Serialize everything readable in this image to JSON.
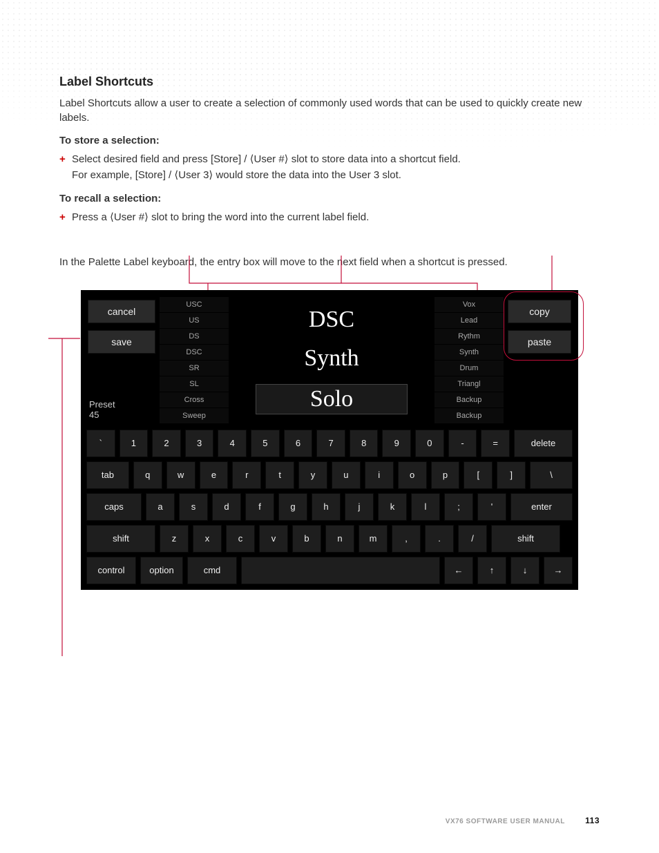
{
  "heading": "Label Shortcuts",
  "intro": "Label Shortcuts allow a user to create a selection of commonly used words that can be used to quickly create new labels.",
  "store_heading": "To store a selection:",
  "store_bullet_line1": "Select desired field and press [Store] / ⟨User #⟩ slot to store data into a shortcut field.",
  "store_bullet_line2": "For example, [Store] / ⟨User 3⟩ would store the data into the User 3 slot.",
  "recall_heading": "To recall a selection:",
  "recall_bullet": "Press a ⟨User #⟩ slot to bring the word into the current label field.",
  "note": "In the Palette Label keyboard, the entry box will move to the next field when a shortcut is pressed.",
  "panel": {
    "cancel": "cancel",
    "save": "save",
    "preset_label": "Preset",
    "preset_num": "45",
    "left_shortcuts": [
      "USC",
      "US",
      "DS",
      "DSC",
      "SR",
      "SL",
      "Cross",
      "Sweep"
    ],
    "entries": [
      "DSC",
      "Synth",
      "Solo"
    ],
    "right_shortcuts": [
      "Vox",
      "Lead",
      "Rythm",
      "Synth",
      "Drum",
      "Triangl",
      "Backup",
      "Backup"
    ],
    "copy": "copy",
    "paste": "paste"
  },
  "keyboard": {
    "row1": [
      "`",
      "1",
      "2",
      "3",
      "4",
      "5",
      "6",
      "7",
      "8",
      "9",
      "0",
      "-",
      "=",
      "delete"
    ],
    "row2": [
      "tab",
      "q",
      "w",
      "e",
      "r",
      "t",
      "y",
      "u",
      "i",
      "o",
      "p",
      "[",
      "]",
      "\\"
    ],
    "row3": [
      "caps",
      "a",
      "s",
      "d",
      "f",
      "g",
      "h",
      "j",
      "k",
      "l",
      ";",
      "'",
      "enter"
    ],
    "row4": [
      "shift",
      "z",
      "x",
      "c",
      "v",
      "b",
      "n",
      "m",
      ",",
      ".",
      "/",
      "shift"
    ],
    "row5": [
      "control",
      "option",
      "cmd",
      " ",
      "←",
      "↑",
      "↓",
      "→"
    ]
  },
  "footer_manual": "VX76 SOFTWARE USER MANUAL",
  "footer_page": "113"
}
